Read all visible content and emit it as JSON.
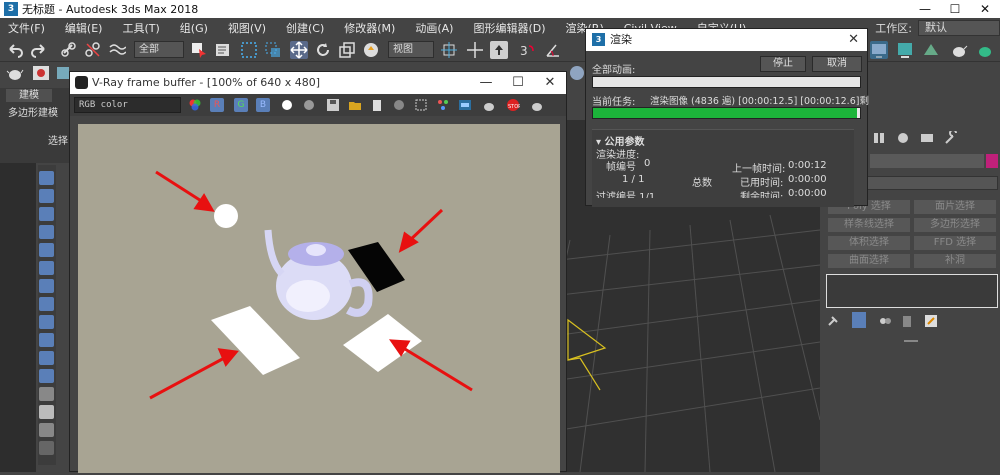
{
  "app": {
    "title": "无标题 - Autodesk 3ds Max 2018",
    "window_controls": [
      "—",
      "☐",
      "✕"
    ]
  },
  "menu": {
    "items": [
      "文件(F)",
      "编辑(E)",
      "工具(T)",
      "组(G)",
      "视图(V)",
      "创建(C)",
      "修改器(M)",
      "动画(A)",
      "图形编辑器(D)",
      "渲染(R)",
      "Civil View",
      "自定义(U)"
    ],
    "workspace_label": "工作区:",
    "workspace_value": "默认"
  },
  "toolbar": {
    "selection_filter": "全部",
    "view_dropdown": "视图"
  },
  "ribbon": {
    "tab_modeling": "建模",
    "tab_poly": "多边形建模",
    "select_label": "选择"
  },
  "vfb": {
    "title": "V-Ray frame buffer - [100% of 640 x 480]",
    "channel": "RGB color",
    "window_controls": [
      "—",
      "☐",
      "✕"
    ]
  },
  "render_dialog": {
    "title": "渲染",
    "close": "✕",
    "total_animation_label": "全部动画:",
    "stop_button": "停止",
    "cancel_button": "取消",
    "current_task_label": "当前任务:",
    "current_task_value": "渲染图像 (4836 遍) [00:00:12.5] [00:00:12.6]剩",
    "current_task_progress": 0.99,
    "total_progress": 0.0,
    "section_title": "公用参数",
    "render_progress_label": "渲染进度:",
    "frame_label": "帧编号",
    "frame_value": "0",
    "frame_count": "1 / 1",
    "total_label": "总数",
    "last_frame_time_label": "上一帧时间:",
    "last_frame_time": "0:00:12",
    "elapsed_label": "已用时间:",
    "elapsed_time": "0:00:00",
    "pass_label": "过滤编号 1/1",
    "remaining_label": "剩余时间:",
    "remaining_time": "0:00:00"
  },
  "command_panel": {
    "buttons": [
      "Poly 选择",
      "面片选择",
      "样条线选择",
      "多边形选择",
      "体积选择",
      "FFD 选择",
      "曲面选择",
      "补洞"
    ],
    "dropdown_partial": "表"
  },
  "colors": {
    "render_bg": "#a8a493",
    "arrow": "#e81010",
    "progress_green": "#1cb43a",
    "accent_pink": "#c0207a"
  }
}
